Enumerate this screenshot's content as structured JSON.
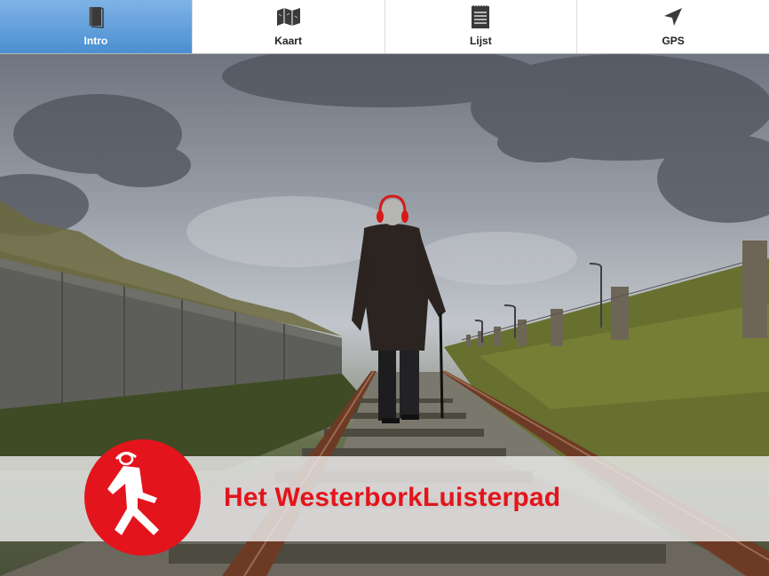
{
  "tabs": [
    {
      "label": "Intro",
      "icon": "book-icon",
      "active": true
    },
    {
      "label": "Kaart",
      "icon": "map-icon",
      "active": false
    },
    {
      "label": "Lijst",
      "icon": "list-icon",
      "active": false
    },
    {
      "label": "GPS",
      "icon": "location-arrow-icon",
      "active": false
    }
  ],
  "banner": {
    "title": "Het WesterborkLuisterpad",
    "logo_icon": "walking-person-headphones-icon"
  },
  "colors": {
    "accent_red": "#e3141b",
    "active_tab": "#5b9bd8"
  }
}
